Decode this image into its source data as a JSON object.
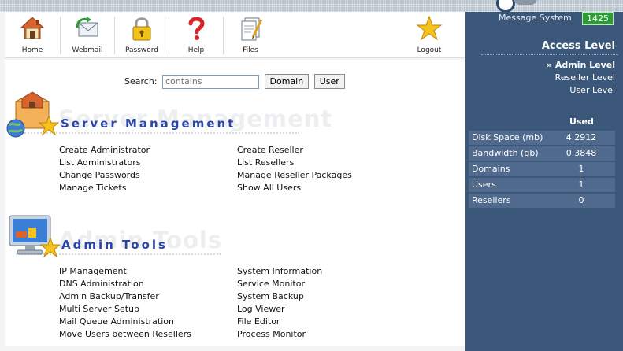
{
  "toolbar": {
    "items": [
      {
        "label": "Home",
        "icon": "home-icon"
      },
      {
        "label": "Webmail",
        "icon": "webmail-icon"
      },
      {
        "label": "Password",
        "icon": "lock-icon"
      },
      {
        "label": "Help",
        "icon": "question-icon"
      },
      {
        "label": "Files",
        "icon": "files-icon"
      },
      {
        "label": "Logout",
        "icon": "star-icon"
      }
    ]
  },
  "search": {
    "label": "Search:",
    "placeholder": "contains",
    "domain_button": "Domain",
    "user_button": "User"
  },
  "server_management": {
    "title": "Server Management",
    "watermark": "Server Management",
    "col1": [
      "Create Administrator",
      "List Administrators",
      "Change Passwords",
      "Manage Tickets"
    ],
    "col2": [
      "Create Reseller",
      "List Resellers",
      "Manage Reseller Packages",
      "Show All Users"
    ]
  },
  "admin_tools": {
    "title": "Admin Tools",
    "watermark": "Admin Tools",
    "col1": [
      "IP Management",
      "DNS Administration",
      "Admin Backup/Transfer",
      "Multi Server Setup",
      "Mail Queue Administration",
      "Move Users between Resellers"
    ],
    "col2": [
      "System Information",
      "Service Monitor",
      "System Backup",
      "Log Viewer",
      "File Editor",
      "Process Monitor"
    ]
  },
  "sidebar": {
    "message_label": "Message System",
    "message_count": "1425",
    "access_title": "Access Level",
    "levels": [
      "» Admin Level",
      "Reseller Level",
      "User Level"
    ],
    "used_header": "Used",
    "stats": [
      {
        "label": "Disk Space (mb)",
        "value": "4.2912"
      },
      {
        "label": "Bandwidth (gb)",
        "value": "0.3848"
      },
      {
        "label": "Domains",
        "value": "1"
      },
      {
        "label": "Users",
        "value": "1"
      },
      {
        "label": "Resellers",
        "value": "0"
      }
    ]
  },
  "colors": {
    "sidebar_bg": "#3b5779",
    "section_title": "#2a45a6",
    "badge_green": "#2e9a35"
  }
}
